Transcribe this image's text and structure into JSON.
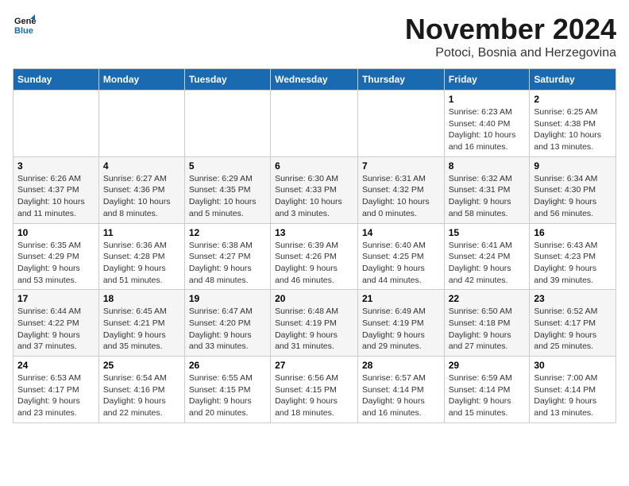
{
  "header": {
    "logo_line1": "General",
    "logo_line2": "Blue",
    "month": "November 2024",
    "location": "Potoci, Bosnia and Herzegovina"
  },
  "days_of_week": [
    "Sunday",
    "Monday",
    "Tuesday",
    "Wednesday",
    "Thursday",
    "Friday",
    "Saturday"
  ],
  "weeks": [
    [
      {
        "day": "",
        "info": ""
      },
      {
        "day": "",
        "info": ""
      },
      {
        "day": "",
        "info": ""
      },
      {
        "day": "",
        "info": ""
      },
      {
        "day": "",
        "info": ""
      },
      {
        "day": "1",
        "info": "Sunrise: 6:23 AM\nSunset: 4:40 PM\nDaylight: 10 hours and 16 minutes."
      },
      {
        "day": "2",
        "info": "Sunrise: 6:25 AM\nSunset: 4:38 PM\nDaylight: 10 hours and 13 minutes."
      }
    ],
    [
      {
        "day": "3",
        "info": "Sunrise: 6:26 AM\nSunset: 4:37 PM\nDaylight: 10 hours and 11 minutes."
      },
      {
        "day": "4",
        "info": "Sunrise: 6:27 AM\nSunset: 4:36 PM\nDaylight: 10 hours and 8 minutes."
      },
      {
        "day": "5",
        "info": "Sunrise: 6:29 AM\nSunset: 4:35 PM\nDaylight: 10 hours and 5 minutes."
      },
      {
        "day": "6",
        "info": "Sunrise: 6:30 AM\nSunset: 4:33 PM\nDaylight: 10 hours and 3 minutes."
      },
      {
        "day": "7",
        "info": "Sunrise: 6:31 AM\nSunset: 4:32 PM\nDaylight: 10 hours and 0 minutes."
      },
      {
        "day": "8",
        "info": "Sunrise: 6:32 AM\nSunset: 4:31 PM\nDaylight: 9 hours and 58 minutes."
      },
      {
        "day": "9",
        "info": "Sunrise: 6:34 AM\nSunset: 4:30 PM\nDaylight: 9 hours and 56 minutes."
      }
    ],
    [
      {
        "day": "10",
        "info": "Sunrise: 6:35 AM\nSunset: 4:29 PM\nDaylight: 9 hours and 53 minutes."
      },
      {
        "day": "11",
        "info": "Sunrise: 6:36 AM\nSunset: 4:28 PM\nDaylight: 9 hours and 51 minutes."
      },
      {
        "day": "12",
        "info": "Sunrise: 6:38 AM\nSunset: 4:27 PM\nDaylight: 9 hours and 48 minutes."
      },
      {
        "day": "13",
        "info": "Sunrise: 6:39 AM\nSunset: 4:26 PM\nDaylight: 9 hours and 46 minutes."
      },
      {
        "day": "14",
        "info": "Sunrise: 6:40 AM\nSunset: 4:25 PM\nDaylight: 9 hours and 44 minutes."
      },
      {
        "day": "15",
        "info": "Sunrise: 6:41 AM\nSunset: 4:24 PM\nDaylight: 9 hours and 42 minutes."
      },
      {
        "day": "16",
        "info": "Sunrise: 6:43 AM\nSunset: 4:23 PM\nDaylight: 9 hours and 39 minutes."
      }
    ],
    [
      {
        "day": "17",
        "info": "Sunrise: 6:44 AM\nSunset: 4:22 PM\nDaylight: 9 hours and 37 minutes."
      },
      {
        "day": "18",
        "info": "Sunrise: 6:45 AM\nSunset: 4:21 PM\nDaylight: 9 hours and 35 minutes."
      },
      {
        "day": "19",
        "info": "Sunrise: 6:47 AM\nSunset: 4:20 PM\nDaylight: 9 hours and 33 minutes."
      },
      {
        "day": "20",
        "info": "Sunrise: 6:48 AM\nSunset: 4:19 PM\nDaylight: 9 hours and 31 minutes."
      },
      {
        "day": "21",
        "info": "Sunrise: 6:49 AM\nSunset: 4:19 PM\nDaylight: 9 hours and 29 minutes."
      },
      {
        "day": "22",
        "info": "Sunrise: 6:50 AM\nSunset: 4:18 PM\nDaylight: 9 hours and 27 minutes."
      },
      {
        "day": "23",
        "info": "Sunrise: 6:52 AM\nSunset: 4:17 PM\nDaylight: 9 hours and 25 minutes."
      }
    ],
    [
      {
        "day": "24",
        "info": "Sunrise: 6:53 AM\nSunset: 4:17 PM\nDaylight: 9 hours and 23 minutes."
      },
      {
        "day": "25",
        "info": "Sunrise: 6:54 AM\nSunset: 4:16 PM\nDaylight: 9 hours and 22 minutes."
      },
      {
        "day": "26",
        "info": "Sunrise: 6:55 AM\nSunset: 4:15 PM\nDaylight: 9 hours and 20 minutes."
      },
      {
        "day": "27",
        "info": "Sunrise: 6:56 AM\nSunset: 4:15 PM\nDaylight: 9 hours and 18 minutes."
      },
      {
        "day": "28",
        "info": "Sunrise: 6:57 AM\nSunset: 4:14 PM\nDaylight: 9 hours and 16 minutes."
      },
      {
        "day": "29",
        "info": "Sunrise: 6:59 AM\nSunset: 4:14 PM\nDaylight: 9 hours and 15 minutes."
      },
      {
        "day": "30",
        "info": "Sunrise: 7:00 AM\nSunset: 4:14 PM\nDaylight: 9 hours and 13 minutes."
      }
    ]
  ]
}
